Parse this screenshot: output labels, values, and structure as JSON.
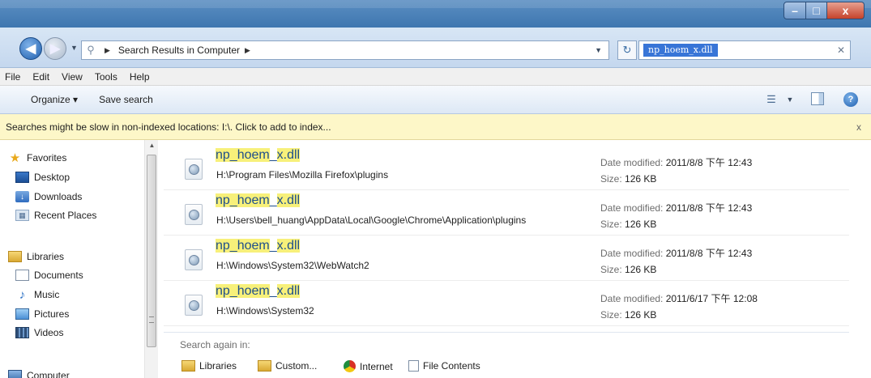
{
  "window": {
    "controls": {
      "minimize": "–",
      "maximize": "□",
      "close": "x"
    }
  },
  "address_bar": {
    "breadcrumb": "Search Results in Computer",
    "search_value": "np_hoem_x.dll"
  },
  "menu": [
    "File",
    "Edit",
    "View",
    "Tools",
    "Help"
  ],
  "toolbar": {
    "organize_label": "Organize ▾",
    "save_search_label": "Save search",
    "icons": [
      "views-icon",
      "preview-pane-icon",
      "help-icon"
    ]
  },
  "infobar": {
    "message": "Searches might be slow in non-indexed locations: I:\\. Click to add to index...",
    "close": "x"
  },
  "nav": {
    "favorites": {
      "label": "Favorites",
      "items": [
        "Desktop",
        "Downloads",
        "Recent Places"
      ]
    },
    "libraries": {
      "label": "Libraries",
      "items": [
        "Documents",
        "Music",
        "Pictures",
        "Videos"
      ]
    },
    "computer": {
      "label": "Computer"
    }
  },
  "results": [
    {
      "name_hl": "np_hoem",
      "name_mid": "_",
      "name_hl2": "x.dll",
      "path": "H:\\Program Files\\Mozilla Firefox\\plugins",
      "modified_label": "Date modified:",
      "modified": "2011/8/8 下午 12:43",
      "size_label": "Size:",
      "size": "126 KB"
    },
    {
      "name_hl": "np_hoem",
      "name_mid": "_",
      "name_hl2": "x.dll",
      "path": "H:\\Users\\bell_huang\\AppData\\Local\\Google\\Chrome\\Application\\plugins",
      "modified_label": "Date modified:",
      "modified": "2011/8/8 下午 12:43",
      "size_label": "Size:",
      "size": "126 KB"
    },
    {
      "name_hl": "np_hoem",
      "name_mid": "_",
      "name_hl2": "x.dll",
      "path": "H:\\Windows\\System32\\WebWatch2",
      "modified_label": "Date modified:",
      "modified": "2011/8/8 下午 12:43",
      "size_label": "Size:",
      "size": "126 KB"
    },
    {
      "name_hl": "np_hoem",
      "name_mid": "_",
      "name_hl2": "x.dll",
      "path": "H:\\Windows\\System32",
      "modified_label": "Date modified:",
      "modified": "2011/6/17 下午 12:08",
      "size_label": "Size:",
      "size": "126 KB"
    }
  ],
  "search_again": {
    "label": "Search again in:",
    "options": [
      "Libraries",
      "Custom...",
      "Internet",
      "File Contents"
    ]
  }
}
